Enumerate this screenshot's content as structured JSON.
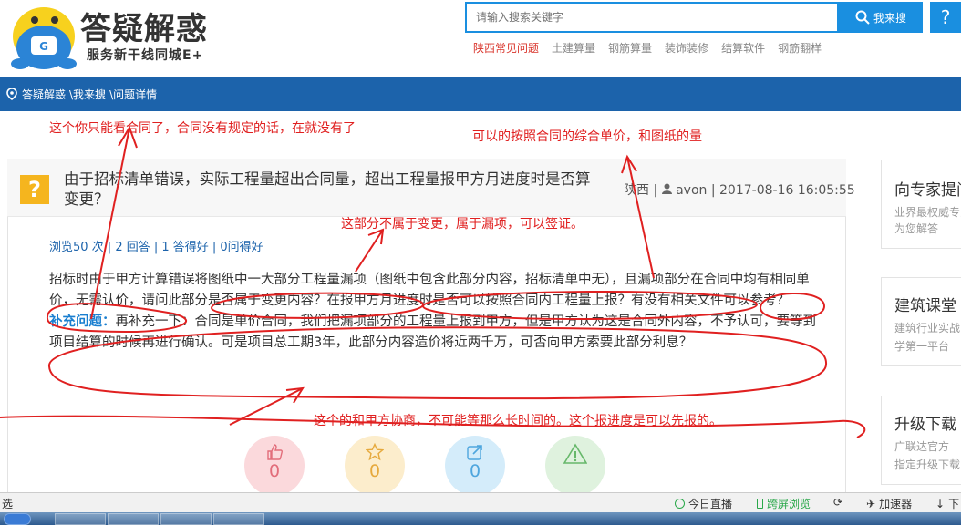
{
  "header": {
    "logo_title": "答疑解惑",
    "logo_sub": "服务新干线同城E+",
    "search_placeholder": "请输入搜索关键字",
    "search_button": "我来搜",
    "help_button": "?",
    "hot_links": [
      "陕西常见问题",
      "土建算量",
      "钢筋算量",
      "装饰装修",
      "结算软件",
      "钢筋翻样"
    ]
  },
  "breadcrumb": {
    "items": [
      "答疑解惑",
      "\\我来搜",
      "\\问题详情"
    ]
  },
  "question": {
    "title": "由于招标清单错误，实际工程量超出合同量，超出工程量报甲方月进度时是否算变更？",
    "meta_region": "陕西",
    "meta_user": "avon",
    "meta_time": "2017-08-16 16:05:55",
    "stats": "浏览50 次 | 2 回答 | 1 答得好 | 0问得好",
    "body": "招标时由于甲方计算错误将图纸中一大部分工程量漏项（图纸中包含此部分内容，招标清单中无），且漏项部分在合同中均有相同单价，无需认价，请问此部分是否属于变更内容？在报甲方月进度时是否可以按照合同内工程量上报？有没有相关文件可以参考？",
    "supp_label": "补充问题：",
    "supp_text": "再补充一下：合同是单价合同，我们把漏项部分的工程量上报到甲方，但是甲方认为这是合同外内容，不予认可，要等到项目结算的时候再进行确认。可是项目总工期3年，此部分内容造价将近两千万，可否向甲方索要此部分利息？",
    "votes": {
      "like": "0",
      "star": "0",
      "share": "0"
    }
  },
  "sidebar": [
    {
      "title": "向专家提问",
      "desc1": "业界最权威专家",
      "desc2": "为您解答"
    },
    {
      "title": "建筑课堂",
      "desc1": "建筑行业实战",
      "desc2": "学第一平台"
    },
    {
      "title": "升级下载",
      "desc1": "广联达官方",
      "desc2": "指定升级下载"
    }
  ],
  "annotations": {
    "a1": "这个你只能看合同了，合同没有规定的话，在就没有了",
    "a2": "可以的按照合同的综合单价，和图纸的量",
    "a3": "这部分不属于变更，属于漏项，可以签证。",
    "a4": "这个的和甲方协商，不可能等那么长时间的。这个报进度是可以先报的。"
  },
  "statusbar": {
    "left": "选",
    "live": "今日直播",
    "cross": "跨屏浏览",
    "accel": "加速器",
    "download": "下"
  },
  "colors": {
    "brand_blue": "#1a8fe0",
    "nav_blue": "#1c63ab",
    "annotation_red": "#e02020",
    "question_icon": "#f5b51e"
  }
}
